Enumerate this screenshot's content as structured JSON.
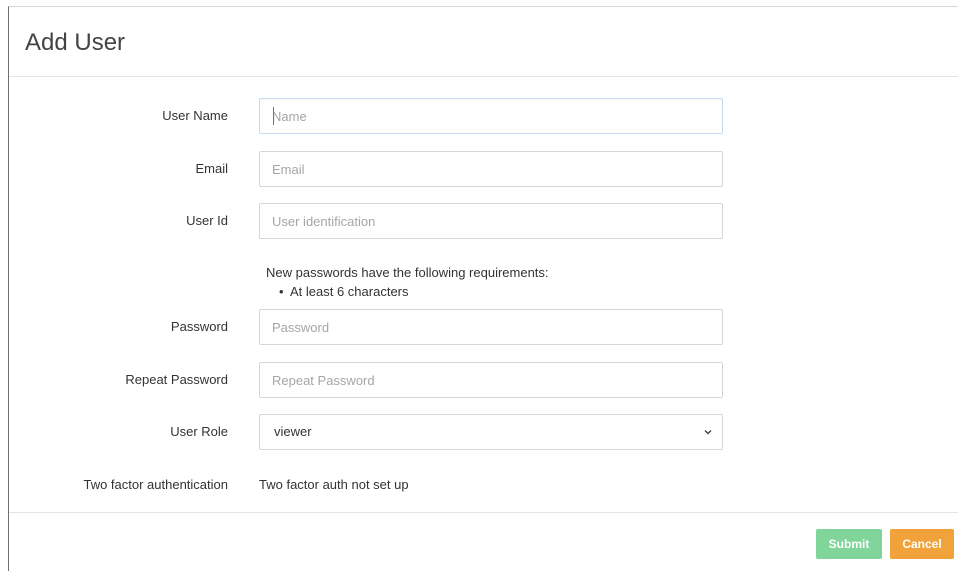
{
  "modal": {
    "title": "Add User"
  },
  "form": {
    "username": {
      "label": "User Name",
      "placeholder": "Name",
      "value": ""
    },
    "email": {
      "label": "Email",
      "placeholder": "Email",
      "value": ""
    },
    "userid": {
      "label": "User Id",
      "placeholder": "User identification",
      "value": ""
    },
    "password_requirements": {
      "intro": "New passwords have the following requirements:",
      "items": [
        "At least 6 characters"
      ]
    },
    "password": {
      "label": "Password",
      "placeholder": "Password",
      "value": ""
    },
    "repeat_password": {
      "label": "Repeat Password",
      "placeholder": "Repeat Password",
      "value": ""
    },
    "role": {
      "label": "User Role",
      "selected": "viewer",
      "icon": "chevron-down-icon"
    },
    "two_factor": {
      "label": "Two factor authentication",
      "value": "Two factor auth not set up"
    }
  },
  "footer": {
    "submit_label": "Submit",
    "cancel_label": "Cancel"
  },
  "colors": {
    "submit": "#7fd59a",
    "cancel": "#f2a23a",
    "focus_caret": "#3d7fc1"
  }
}
